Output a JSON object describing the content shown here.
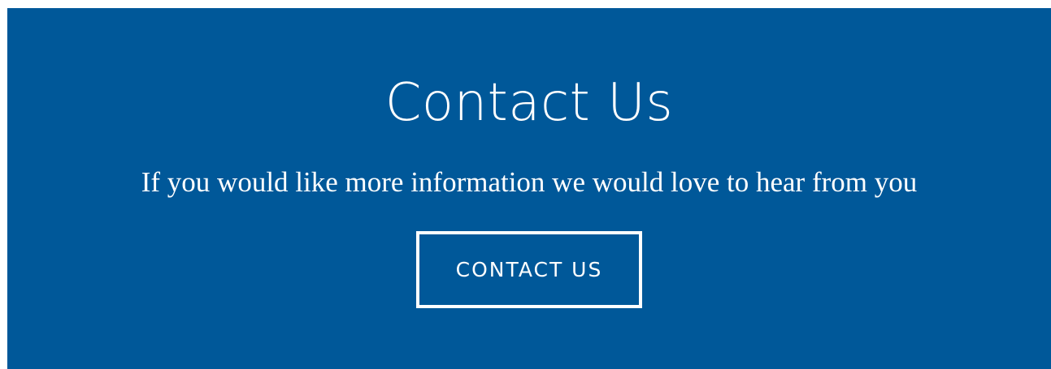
{
  "contact": {
    "title": "Contact Us",
    "subtitle": "If you would like more information we would love to hear from you",
    "button_label": "CONTACT US"
  },
  "colors": {
    "background": "#005899",
    "text": "#ffffff"
  }
}
